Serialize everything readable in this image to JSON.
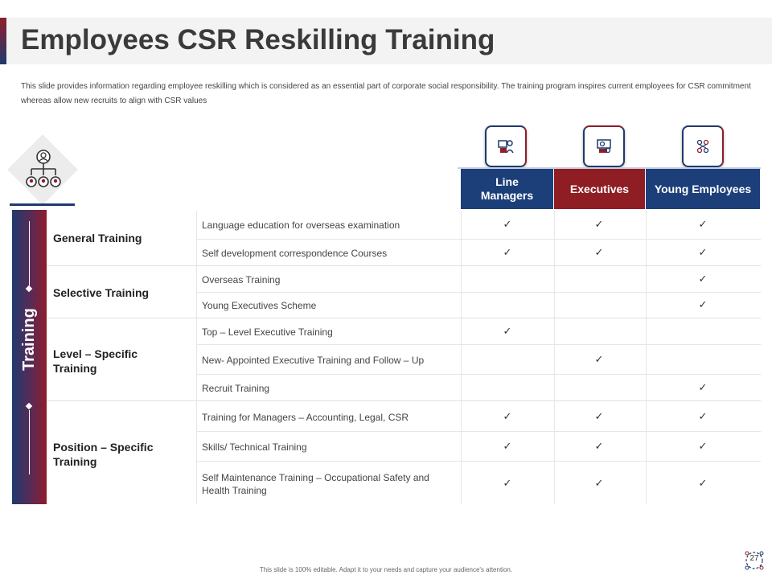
{
  "title": "Employees CSR Reskilling Training",
  "description": "This slide provides information regarding employee reskilling which is considered as an essential part of corporate social responsibility. The training program inspires current employees for CSR commitment whereas allow new recruits to align with CSR values",
  "side_label": "Training",
  "columns": [
    "Line Managers",
    "Executives",
    "Young Employees"
  ],
  "categories": [
    {
      "name": "General Training"
    },
    {
      "name": "Selective Training"
    },
    {
      "name": "Level – Specific Training"
    },
    {
      "name": "Position – Specific Training"
    }
  ],
  "rows": [
    {
      "label": "Language education for overseas  examination",
      "checks": [
        true,
        true,
        true
      ]
    },
    {
      "label": "Self development  correspondence  Courses",
      "checks": [
        true,
        true,
        true
      ]
    },
    {
      "label": "Overseas Training",
      "checks": [
        false,
        false,
        true
      ]
    },
    {
      "label": "Young Executives Scheme",
      "checks": [
        false,
        false,
        true
      ]
    },
    {
      "label": "Top – Level  Executive Training",
      "checks": [
        true,
        false,
        false
      ]
    },
    {
      "label": "New- Appointed Executive  Training and Follow – Up",
      "checks": [
        false,
        true,
        false
      ]
    },
    {
      "label": "Recruit Training",
      "checks": [
        false,
        false,
        true
      ]
    },
    {
      "label": "Training for Managers – Accounting, Legal, CSR",
      "checks": [
        true,
        true,
        true
      ]
    },
    {
      "label": "Skills/ Technical Training",
      "checks": [
        true,
        true,
        true
      ]
    },
    {
      "label": "Self Maintenance Training  –  Occupational Safety and Health Training",
      "checks": [
        true,
        true,
        true
      ]
    }
  ],
  "check_mark": "✓",
  "footer": "This slide is 100% editable. Adapt it to your needs and capture your audience's attention.",
  "page_number": "27",
  "colors": {
    "navy": "#1c3f7a",
    "crimson": "#8f1d24"
  }
}
